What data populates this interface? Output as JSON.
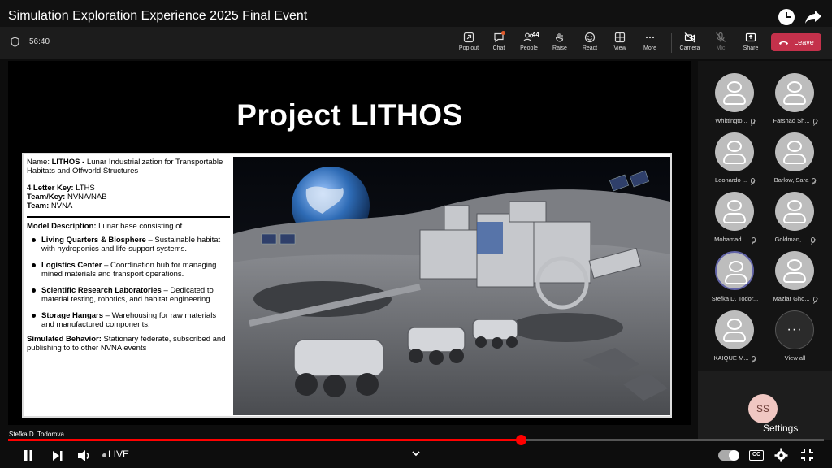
{
  "video": {
    "title": "Simulation Exploration Experience 2025 Final Event"
  },
  "meeting": {
    "timer": "56:40",
    "toolbar": [
      {
        "id": "popout",
        "label": "Pop out",
        "icon": "pop-out-icon"
      },
      {
        "id": "chat",
        "label": "Chat",
        "icon": "chat-icon"
      },
      {
        "id": "people",
        "label": "People",
        "icon": "people-icon",
        "count": "44"
      },
      {
        "id": "raise",
        "label": "Raise",
        "icon": "raise-hand-icon"
      },
      {
        "id": "react",
        "label": "React",
        "icon": "react-icon"
      },
      {
        "id": "view",
        "label": "View",
        "icon": "view-icon"
      },
      {
        "id": "more",
        "label": "More",
        "icon": "more-icon"
      },
      {
        "id": "camera",
        "label": "Camera",
        "icon": "camera-off-icon"
      },
      {
        "id": "mic",
        "label": "Mic",
        "icon": "mic-off-icon"
      },
      {
        "id": "share",
        "label": "Share",
        "icon": "share-icon"
      }
    ],
    "leave_label": "Leave",
    "leave_color": "#c4314b",
    "speaker": "Stefka D. Todorova",
    "participants": [
      {
        "name": "Whittingto...",
        "muted": true
      },
      {
        "name": "Farshad Sh...",
        "muted": true
      },
      {
        "name": "Leonardo ...",
        "muted": true
      },
      {
        "name": "Barlow, Sara",
        "muted": true
      },
      {
        "name": "Mohamad ...",
        "muted": true
      },
      {
        "name": "Goldman, ...",
        "muted": true
      },
      {
        "name": "Stefka D. Todor...",
        "muted": false,
        "speaking": true
      },
      {
        "name": "Maziar Gho...",
        "muted": true
      },
      {
        "name": "KAIQUE M...",
        "muted": true
      }
    ],
    "view_all_label": "View all",
    "self_initials": "SS"
  },
  "slide": {
    "title": "Project LITHOS",
    "name_label": "Name: ",
    "name_bold": "LITHOS - ",
    "name_text": "Lunar Industrialization for Transportable Habitats and Offworld Structures",
    "key_label": "4 Letter Key: ",
    "key_value": "LTHS",
    "teamkey_label": "Team/Key: ",
    "teamkey_value": "NVNA/NAB",
    "team_label": "Team: ",
    "team_value": "NVNA",
    "model_label": "Model Description: ",
    "model_text": "Lunar base consisting of",
    "bullets": [
      {
        "bold": "Living Quarters & Biosphere",
        "text": " – Sustainable habitat with hydroponics and life-support systems."
      },
      {
        "bold": "Logistics Center",
        "text": " – Coordination hub for managing mined materials and transport operations."
      },
      {
        "bold": "Scientific Research Laboratories",
        "text": " – Dedicated to material testing, robotics, and habitat engineering."
      },
      {
        "bold": "Storage Hangars",
        "text": " – Warehousing for raw materials and manufactured components."
      }
    ],
    "behavior_label": "Simulated Behavior: ",
    "behavior_text": "Stationary federate, subscribed and publishing to to other NVNA events"
  },
  "player": {
    "live_label": "LIVE",
    "settings_tooltip": "Settings",
    "progress": 0.628,
    "accent": "#ff0000"
  }
}
